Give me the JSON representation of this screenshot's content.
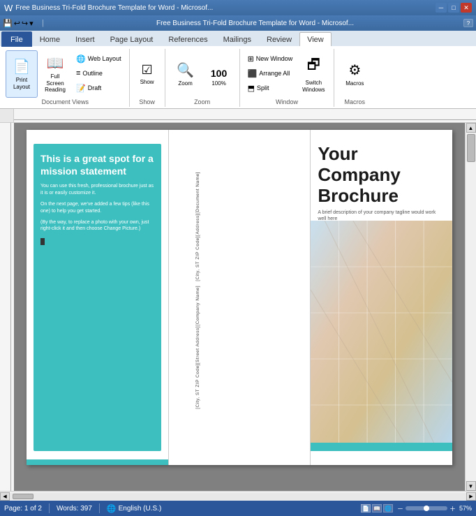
{
  "titlebar": {
    "title": "Free Business Tri-Fold Brochure Template for Word - Microsof...",
    "minimize": "─",
    "restore": "□",
    "close": "✕"
  },
  "quickaccess": {
    "save": "💾",
    "undo": "↩",
    "redo": "↪",
    "dropdown": "▾"
  },
  "tabs": {
    "file": "File",
    "home": "Home",
    "insert": "Insert",
    "pagelayout": "Page Layout",
    "references": "References",
    "mailings": "Mailings",
    "review": "Review",
    "view": "View"
  },
  "ribbon": {
    "printlayout": {
      "label": "Print\nLayout",
      "icon": "📄"
    },
    "fullscreen": {
      "label": "Full Screen\nReading",
      "icon": "📖"
    },
    "weblayout": {
      "label": "Web Layout",
      "icon": "🌐"
    },
    "outline": {
      "label": "Outline",
      "icon": "≡"
    },
    "draft": {
      "label": "Draft",
      "icon": "📝"
    },
    "group_documentviews": "Document Views",
    "show_label": "Show",
    "show_icon": "□",
    "zoom_label": "Zoom",
    "zoom_icon": "🔍",
    "zoom_100": "100%",
    "group_zoom": "Zoom",
    "newwindow": {
      "label": "New Window",
      "icon": "⊞"
    },
    "arrange": {
      "label": "Arrange All",
      "icon": "⬛"
    },
    "split": {
      "label": "Split",
      "icon": "⬒"
    },
    "switchwindows": {
      "label": "Switch\nWindows",
      "icon": "🗗"
    },
    "group_window": "Window",
    "macros": {
      "label": "Macros",
      "icon": "⚙"
    },
    "group_macros": "Macros"
  },
  "brochure": {
    "mission_title": "This is a great spot for a mission statement",
    "mission_body1": "You can use this fresh, professional brochure just as it is or easily customize it.",
    "mission_body2": "On the next page, we've added a few tips (like this one) to help you get started.",
    "mission_body3": "(By the way, to replace a photo with your own, just right-click it and then choose Change Picture.)",
    "company_title": "Your\nCompany\nBrochure",
    "company_subtitle": "A brief description of your company tagline would work well here",
    "address_top1": "[Document Name]",
    "address_top2": "[Address]",
    "address_top3": "[City, ST  ZIP Code]",
    "address_bottom1": "[Company Name]",
    "address_bottom2": "[Street Address]",
    "address_bottom3": "[City, ST  ZIP Code]"
  },
  "statusbar": {
    "page": "Page: 1 of 2",
    "words": "Words: 397",
    "lang": "English (U.S.)",
    "zoom_pct": "57%"
  }
}
